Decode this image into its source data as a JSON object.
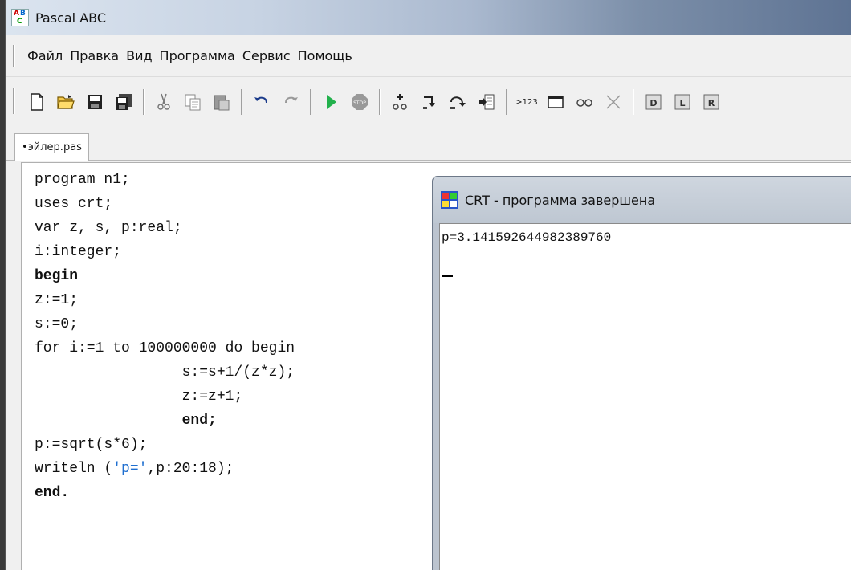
{
  "window": {
    "title": "Pascal ABC"
  },
  "menu": {
    "items": [
      "Файл",
      "Правка",
      "Вид",
      "Программа",
      "Сервис",
      "Помощь"
    ]
  },
  "toolbar": {
    "icons": [
      "new-file-icon",
      "open-folder-icon",
      "save-icon",
      "save-all-icon",
      "cut-icon",
      "copy-icon",
      "paste-icon",
      "undo-icon",
      "redo-icon",
      "run-icon",
      "stop-icon",
      "add-watch-icon",
      "step-into-icon",
      "step-over-icon",
      "run-to-cursor-icon",
      "eval-expression-icon",
      "output-window-icon",
      "watch-icon",
      "close-icon",
      "debug-d-icon",
      "debug-l-icon",
      "debug-r-icon"
    ],
    "eval_label": ">123"
  },
  "tab": {
    "label": "•эйлер.pas"
  },
  "editor": {
    "lines": [
      "program n1;",
      "uses crt;",
      "var z, s, p:real;",
      "i:integer;",
      "begin",
      "z:=1;",
      "s:=0;",
      "for i:=1 to 100000000 do begin",
      "                 s:=s+1/(z*z);",
      "                 z:=z+1;",
      "                 end;",
      "p:=sqrt(s*6);",
      "writeln ('p=',p:20:18);",
      "end."
    ]
  },
  "crt": {
    "title": "CRT - программа завершена",
    "output": "p=3.141592644982389760"
  },
  "colors": {
    "string_literal": "#1f6fd0",
    "titlebar_end": "#5e7393"
  }
}
